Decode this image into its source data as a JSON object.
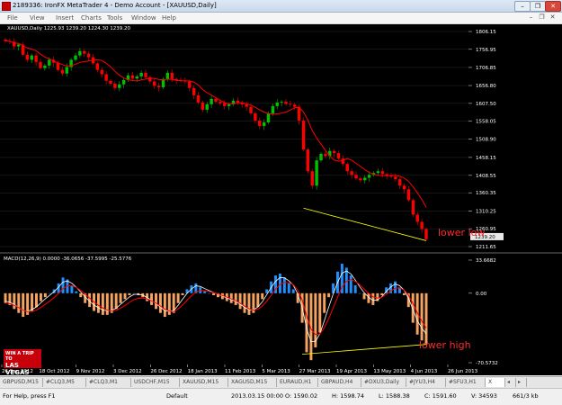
{
  "window": {
    "title": "2189336: IronFX MetaTrader 4 - Demo Account - [XAUUSD,Daily]",
    "controls": [
      "–",
      "❐",
      "✕"
    ]
  },
  "menu": {
    "items": [
      "File",
      "View",
      "Insert",
      "Charts",
      "Tools",
      "Window",
      "Help"
    ],
    "mdi_controls": [
      "–",
      "❐",
      "✕"
    ]
  },
  "chart": {
    "symbol_info": "XAUUSD,Daily  1225.93 1239.20 1224.30 1239.20",
    "macd_label": "MACD(12,26,9) 0.0000 -36.0656 -37.5995 -25.5776",
    "annotations": {
      "lower_low": "lower low",
      "lower_high": "lower high"
    },
    "colors": {
      "background": "#000000",
      "bull": "#00c000",
      "bear": "#ff0000",
      "ma": "#ff0000",
      "histogram_pos": "#1e90ff",
      "histogram_neg": "#f4a460",
      "trendline": "#ffff00"
    },
    "ad": {
      "line1": "WIN A TRIP TO",
      "line2": "LAS VEGAS"
    }
  },
  "chart_data": [
    {
      "type": "candlestick",
      "title": "XAUUSD,Daily",
      "price_axis_ticks": [
        "1806.15",
        "1756.95",
        "1706.85",
        "1656.80",
        "1607.50",
        "1558.05",
        "1508.90",
        "1458.15",
        "1408.55",
        "1360.35",
        "1310.25",
        "1260.95",
        "1211.65"
      ],
      "current_price": "1239.20",
      "x_tick_labels": [
        "26 Sep 2012",
        "18 Oct 2012",
        "9 Nov 2012",
        "3 Dec 2012",
        "26 Dec 2012",
        "18 Jan 2013",
        "11 Feb 2013",
        "5 Mar 2013",
        "27 Mar 2013",
        "19 Apr 2013",
        "13 May 2013",
        "4 Jun 2013",
        "26 Jun 2013"
      ],
      "close_path": [
        1780,
        1778,
        1765,
        1770,
        1742,
        1728,
        1740,
        1722,
        1705,
        1712,
        1728,
        1720,
        1700,
        1690,
        1708,
        1728,
        1740,
        1752,
        1745,
        1735,
        1718,
        1700,
        1688,
        1670,
        1662,
        1650,
        1660,
        1672,
        1685,
        1676,
        1682,
        1692,
        1680,
        1668,
        1656,
        1652,
        1675,
        1692,
        1675,
        1672,
        1670,
        1668,
        1650,
        1630,
        1610,
        1590,
        1605,
        1620,
        1612,
        1608,
        1600,
        1605,
        1615,
        1610,
        1605,
        1598,
        1580,
        1560,
        1545,
        1555,
        1580,
        1600,
        1610,
        1612,
        1606,
        1604,
        1598,
        1560,
        1480,
        1420,
        1380,
        1450,
        1468,
        1462,
        1476,
        1470,
        1455,
        1440,
        1420,
        1410,
        1400,
        1395,
        1402,
        1410,
        1415,
        1420,
        1412,
        1408,
        1405,
        1398,
        1380,
        1370,
        1340,
        1300,
        1280,
        1260,
        1232
      ]
    },
    {
      "type": "bar",
      "title": "MACD(12,26,9)",
      "y_axis_ticks": [
        "33.6682",
        "0.00",
        "-70.5732"
      ],
      "values": [
        -10,
        -12,
        -16,
        -20,
        -24,
        -22,
        -18,
        -14,
        -8,
        -4,
        0,
        4,
        10,
        16,
        14,
        8,
        2,
        -4,
        -10,
        -14,
        -18,
        -20,
        -22,
        -22,
        -20,
        -16,
        -10,
        -6,
        -2,
        0,
        -2,
        -4,
        -8,
        -12,
        -16,
        -20,
        -24,
        -22,
        -20,
        -10,
        -2,
        4,
        8,
        10,
        6,
        2,
        0,
        -2,
        -4,
        -6,
        -8,
        -10,
        -12,
        -16,
        -20,
        -22,
        -20,
        -14,
        -6,
        4,
        12,
        18,
        20,
        16,
        10,
        4,
        -10,
        -30,
        -60,
        -68,
        -55,
        -40,
        -20,
        -4,
        10,
        22,
        30,
        26,
        18,
        8,
        0,
        -6,
        -10,
        -12,
        -8,
        -2,
        6,
        10,
        12,
        6,
        -2,
        -14,
        -30,
        -42,
        -48,
        -52
      ]
    }
  ],
  "tabs": [
    "GBPUSD,M15",
    "#CLQ3,M5",
    "#CLQ3,M1",
    "USDCHF,M15",
    "XAUUSD,M15",
    "XAGUSD,M15",
    "EURAUD,H1",
    "GBPAUD,H4",
    "#DXU3,Daily",
    "#JYU3,H4",
    "#SFU3,H1",
    "X"
  ],
  "status": {
    "help": "For Help, press F1",
    "profile": "Default",
    "datetime": "2013.03.15 00:00",
    "open": "O: 1590.02",
    "high": "H: 1598.74",
    "low": "L: 1588.38",
    "close": "C: 1591.60",
    "volume": "V: 34593",
    "traffic": "661/3 kb"
  }
}
